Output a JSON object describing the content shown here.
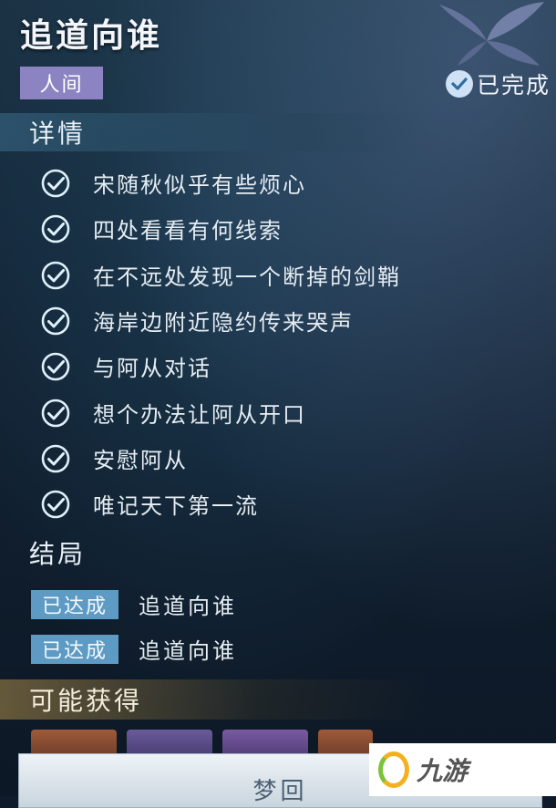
{
  "quest": {
    "title": "追道向谁",
    "region": "人间",
    "status": "已完成"
  },
  "details": {
    "header": "详情",
    "tasks": [
      "宋随秋似乎有些烦心",
      "四处看看有何线索",
      "在不远处发现一个断掉的剑鞘",
      "海岸边附近隐约传来哭声",
      "与阿从对话",
      "想个办法让阿从开口",
      "安慰阿从",
      "唯记天下第一流"
    ]
  },
  "ending": {
    "header": "结局",
    "items": [
      {
        "badge": "已达成",
        "name": "追道向谁"
      },
      {
        "badge": "已达成",
        "name": "追道向谁"
      }
    ]
  },
  "rewards": {
    "header": "可能获得"
  },
  "action": {
    "dream_label": "梦回"
  },
  "watermark": {
    "text": "九游"
  },
  "colors": {
    "region_tag": "#8c84c2",
    "ending_badge": "#5d9bc4",
    "check_color": "#dff1fb"
  },
  "icons": {
    "task_check": "circle-check-icon",
    "status_check": "check-icon",
    "decor": "butterfly-icon"
  }
}
